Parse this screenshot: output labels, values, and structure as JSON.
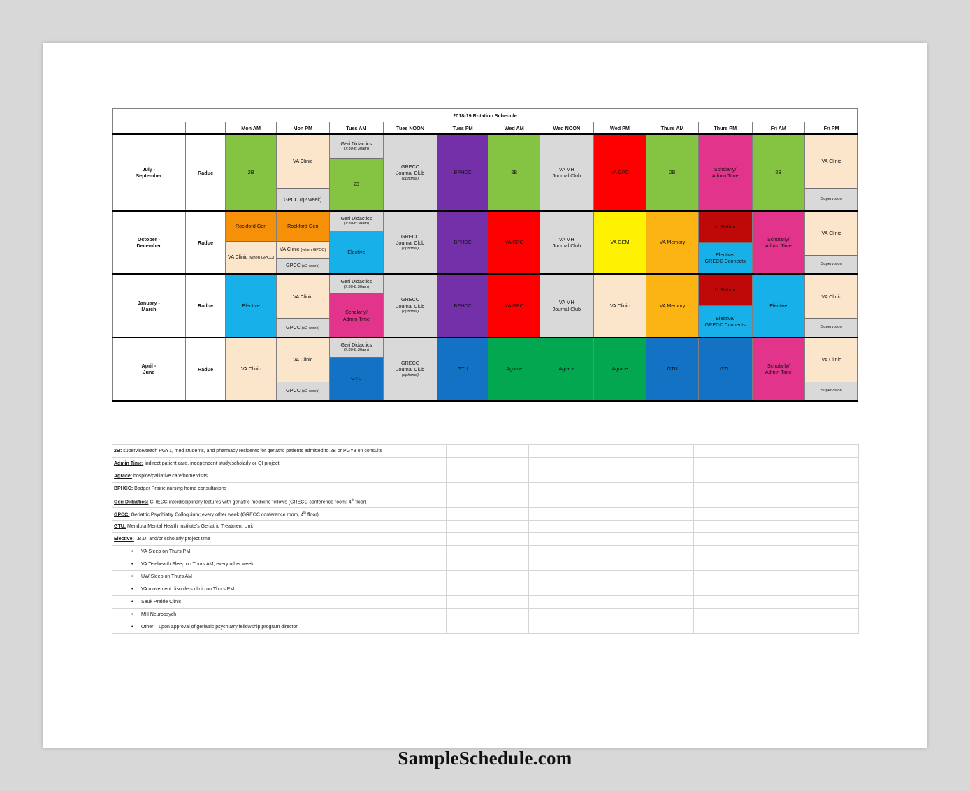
{
  "page": {
    "title": "2018-19 Rotation Schedule",
    "watermark": "SampleSchedule.com"
  },
  "columns": [
    {
      "key": "period",
      "label": ""
    },
    {
      "key": "fellow",
      "label": ""
    },
    {
      "key": "mon_am",
      "label": "Mon AM"
    },
    {
      "key": "mon_pm",
      "label": "Mon PM"
    },
    {
      "key": "tues_am",
      "label": "Tues AM"
    },
    {
      "key": "tues_noon",
      "label": "Tues NOON"
    },
    {
      "key": "tues_pm",
      "label": "Tues PM"
    },
    {
      "key": "wed_am",
      "label": "Wed AM"
    },
    {
      "key": "wed_noon",
      "label": "Wed NOON"
    },
    {
      "key": "wed_pm",
      "label": "Wed PM"
    },
    {
      "key": "thurs_am",
      "label": "Thurs AM"
    },
    {
      "key": "thurs_pm",
      "label": "Thurs PM"
    },
    {
      "key": "fri_am",
      "label": "Fri AM"
    },
    {
      "key": "fri_pm",
      "label": "Fri PM"
    }
  ],
  "colors": {
    "green": "#85c442",
    "cream": "#fbe5cb",
    "gray": "#d9d9d9",
    "purple": "#7330a8",
    "red": "#fe0000",
    "pink": "#e1348a",
    "orange": "#f79009",
    "cyan": "#17b0e8",
    "yellow": "#fff200",
    "amber": "#fcb415",
    "darkred": "#bf0908",
    "blue": "#1372c4",
    "emerald": "#03a74f",
    "white": "#ffffff"
  },
  "rows": [
    {
      "period": "July - September",
      "period_line1": "July -",
      "period_line2": "September",
      "fellow": "Radue",
      "cells": {
        "mon_am": {
          "segments": [
            {
              "text": "2B",
              "color": "green",
              "flex": 1
            }
          ]
        },
        "mon_pm": {
          "segments": [
            {
              "text": "VA Clinic",
              "color": "cream",
              "flex": 72
            },
            {
              "text": "GPCC (q2 week)",
              "color": "gray",
              "flex": 28,
              "note": "(q2 week)",
              "main": "GPCC"
            }
          ]
        },
        "tues_am": {
          "segments": [
            {
              "main": "Geri Didactics",
              "note": "(7:30-8:30am)",
              "color": "gray",
              "flex": 30
            },
            {
              "text": "23",
              "color": "green",
              "flex": 70
            }
          ]
        },
        "tues_noon": {
          "segments": [
            {
              "main": "GRECC",
              "main2": "Journal Club",
              "note_ital": "(optional)",
              "color": "gray",
              "flex": 1
            }
          ]
        },
        "tues_pm": {
          "segments": [
            {
              "text": "BPHCC",
              "color": "purple",
              "flex": 1
            }
          ]
        },
        "wed_am": {
          "segments": [
            {
              "text": "2B",
              "color": "green",
              "flex": 1
            }
          ]
        },
        "wed_noon": {
          "segments": [
            {
              "main": "VA MH",
              "main2": "Journal Club",
              "color": "gray",
              "flex": 1
            }
          ]
        },
        "wed_pm": {
          "segments": [
            {
              "text": "VA GPC",
              "color": "red",
              "flex": 1
            }
          ]
        },
        "thurs_am": {
          "segments": [
            {
              "text": "2B",
              "color": "green",
              "flex": 1
            }
          ]
        },
        "thurs_pm": {
          "segments": [
            {
              "main": "Scholarly/",
              "main2": "Admin Time",
              "color": "pink",
              "flex": 1
            }
          ]
        },
        "fri_am": {
          "segments": [
            {
              "text": "2B",
              "color": "green",
              "flex": 1
            }
          ]
        },
        "fri_pm": {
          "segments": [
            {
              "text": "VA Clinic",
              "color": "cream",
              "flex": 72
            },
            {
              "text": "Supervision",
              "color": "gray",
              "flex": 28,
              "small": true
            }
          ]
        }
      }
    },
    {
      "period": "October - December",
      "period_line1": "October -",
      "period_line2": "December",
      "fellow": "Radue",
      "cells": {
        "mon_am": {
          "segments": [
            {
              "text": "Rockford Geri",
              "color": "orange",
              "flex": 48
            },
            {
              "main": "VA Clinic",
              "note": "(when GPCC)",
              "color": "cream",
              "flex": 52
            }
          ]
        },
        "mon_pm": {
          "segments": [
            {
              "text": "Rockford Geri",
              "color": "orange",
              "flex": 50
            },
            {
              "main": "VA Clinic",
              "note": "(when GPCC)",
              "color": "cream",
              "flex": 26
            },
            {
              "main": "GPCC",
              "note": "(q2 week)",
              "color": "gray",
              "flex": 24
            }
          ]
        },
        "tues_am": {
          "segments": [
            {
              "main": "Geri Didactics",
              "note": "(7:30-8:30am)",
              "color": "gray",
              "flex": 30
            },
            {
              "text": "Elective",
              "color": "cyan",
              "flex": 70
            }
          ]
        },
        "tues_noon": {
          "segments": [
            {
              "main": "GRECC",
              "main2": "Journal Club",
              "note_ital": "(optional)",
              "color": "gray",
              "flex": 1
            }
          ]
        },
        "tues_pm": {
          "segments": [
            {
              "text": "BPHCC",
              "color": "purple",
              "flex": 1
            }
          ]
        },
        "wed_am": {
          "segments": [
            {
              "text": "VA GPC",
              "color": "red",
              "flex": 1
            }
          ]
        },
        "wed_noon": {
          "segments": [
            {
              "main": "VA MH",
              "main2": "Journal Club",
              "color": "gray",
              "flex": 1
            }
          ]
        },
        "wed_pm": {
          "segments": [
            {
              "text": "VA GEM",
              "color": "yellow",
              "flex": 1
            }
          ]
        },
        "thurs_am": {
          "segments": [
            {
              "text": "VA Memory",
              "color": "amber",
              "flex": 1
            }
          ]
        },
        "thurs_pm": {
          "segments": [
            {
              "text": "U Station",
              "color": "darkred",
              "flex": 50
            },
            {
              "main": "Elective/",
              "main2": "GRECC Connects",
              "color": "cyan",
              "flex": 50
            }
          ]
        },
        "fri_am": {
          "segments": [
            {
              "main": "Scholarly/",
              "main2": "Admin Time",
              "color": "pink",
              "flex": 1
            }
          ]
        },
        "fri_pm": {
          "segments": [
            {
              "text": "VA Clinic",
              "color": "cream",
              "flex": 72
            },
            {
              "text": "Supervision",
              "color": "gray",
              "flex": 28,
              "small": true
            }
          ]
        }
      }
    },
    {
      "period": "January - March",
      "period_line1": "January -",
      "period_line2": "March",
      "fellow": "Radue",
      "cells": {
        "mon_am": {
          "segments": [
            {
              "text": "Elective",
              "color": "cyan",
              "flex": 1
            }
          ]
        },
        "mon_pm": {
          "segments": [
            {
              "text": "VA Clinic",
              "color": "cream",
              "flex": 72
            },
            {
              "main": "GPCC",
              "note": "(q2 week)",
              "color": "gray",
              "flex": 28
            }
          ]
        },
        "tues_am": {
          "segments": [
            {
              "main": "Geri Didactics",
              "note": "(7:30-8:30am)",
              "color": "gray",
              "flex": 30
            },
            {
              "main": "Scholarly/",
              "main2": "Admin Time",
              "color": "pink",
              "flex": 70
            }
          ]
        },
        "tues_noon": {
          "segments": [
            {
              "main": "GRECC",
              "main2": "Journal Club",
              "note_ital": "(optional)",
              "color": "gray",
              "flex": 1
            }
          ]
        },
        "tues_pm": {
          "segments": [
            {
              "text": "BPHCC",
              "color": "purple",
              "flex": 1
            }
          ]
        },
        "wed_am": {
          "segments": [
            {
              "text": "VA GPC",
              "color": "red",
              "flex": 1
            }
          ]
        },
        "wed_noon": {
          "segments": [
            {
              "main": "VA MH",
              "main2": "Journal Club",
              "color": "gray",
              "flex": 1
            }
          ]
        },
        "wed_pm": {
          "segments": [
            {
              "text": "VA Clinic",
              "color": "cream",
              "flex": 1
            }
          ]
        },
        "thurs_am": {
          "segments": [
            {
              "text": "VA Memory",
              "color": "amber",
              "flex": 1
            }
          ]
        },
        "thurs_pm": {
          "segments": [
            {
              "text": "U Station",
              "color": "darkred",
              "flex": 50
            },
            {
              "main": "Elective/",
              "main2": "GRECC Connects",
              "color": "cyan",
              "flex": 50
            }
          ]
        },
        "fri_am": {
          "segments": [
            {
              "text": "Elective",
              "color": "cyan",
              "flex": 1
            }
          ]
        },
        "fri_pm": {
          "segments": [
            {
              "text": "VA Clinic",
              "color": "cream",
              "flex": 72
            },
            {
              "text": "Supervision",
              "color": "gray",
              "flex": 28,
              "small": true
            }
          ]
        }
      }
    },
    {
      "period": "April - June",
      "period_line1": "April -",
      "period_line2": "June",
      "fellow": "Radue",
      "cells": {
        "mon_am": {
          "segments": [
            {
              "text": "VA Clinic",
              "color": "cream",
              "flex": 1
            }
          ]
        },
        "mon_pm": {
          "segments": [
            {
              "text": "VA Clinic",
              "color": "cream",
              "flex": 72
            },
            {
              "main": "GPCC",
              "note": "(q2 week)",
              "color": "gray",
              "flex": 28
            }
          ]
        },
        "tues_am": {
          "segments": [
            {
              "main": "Geri Didactics",
              "note": "(7:30-8:30am)",
              "color": "gray",
              "flex": 30
            },
            {
              "text": "GTU",
              "color": "blue",
              "flex": 70
            }
          ]
        },
        "tues_noon": {
          "segments": [
            {
              "main": "GRECC",
              "main2": "Journal Club",
              "note_ital": "(optional)",
              "color": "gray",
              "flex": 1
            }
          ]
        },
        "tues_pm": {
          "segments": [
            {
              "text": "GTU",
              "color": "blue",
              "flex": 1
            }
          ]
        },
        "wed_am": {
          "segments": [
            {
              "text": "Agrace",
              "color": "emerald",
              "flex": 1
            }
          ]
        },
        "wed_noon": {
          "segments": [
            {
              "text": "Agrace",
              "color": "emerald",
              "flex": 1
            }
          ]
        },
        "wed_pm": {
          "segments": [
            {
              "text": "Agrace",
              "color": "emerald",
              "flex": 1
            }
          ]
        },
        "thurs_am": {
          "segments": [
            {
              "text": "GTU",
              "color": "blue",
              "flex": 1
            }
          ]
        },
        "thurs_pm": {
          "segments": [
            {
              "text": "GTU",
              "color": "blue",
              "flex": 1
            }
          ]
        },
        "fri_am": {
          "segments": [
            {
              "main": "Scholarly/",
              "main2": "Admin Time",
              "color": "pink",
              "flex": 1
            }
          ]
        },
        "fri_pm": {
          "segments": [
            {
              "text": "VA Clinic",
              "color": "cream",
              "flex": 72
            },
            {
              "text": "Supervision",
              "color": "gray",
              "flex": 28,
              "small": true
            }
          ]
        }
      }
    }
  ],
  "legend": [
    {
      "term": "2B:",
      "desc": "supervise/teach PGY1, med students, and pharmacy residents for geriatric patients admitted to 2B or PGY3 on consults"
    },
    {
      "term": "Admin Time:",
      "desc": "indirect patient care, independent study/scholarly or QI project"
    },
    {
      "term": "Agrace:",
      "desc": "hospice/palliative care/home visits"
    },
    {
      "term": "BPHCC:",
      "desc": "Badger Prairie nursing home consultations"
    },
    {
      "term": "Geri Didactics:",
      "desc": "GRECC interdisciplinary lectures with geriatric medicine fellows (GRECC conference room: 4th floor)",
      "sup": "th",
      "pre": "GRECC interdisciplinary lectures with geriatric medicine fellows (GRECC conference room: 4",
      "post": " floor)"
    },
    {
      "term": "GPCC:",
      "desc": "Geriatric Psychiatry Colloquium; every other week (GRECC conference room, 4th floor)",
      "sup": "th",
      "pre": "Geriatric Psychiatry Colloquium; every other week (GRECC conference room, 4",
      "post": " floor)"
    },
    {
      "term": "GTU:",
      "desc": "Mendota Mental Health Institute's Geriatric Treatment Unit"
    },
    {
      "term": "Elective:",
      "desc": "I.B.D. and/or scholarly project time"
    }
  ],
  "bullets": [
    "VA Sleep on Thurs PM",
    "VA Telehealth Sleep on Thurs AM; every other week",
    "UW Sleep on Thurs AM",
    "VA movement disorders clinic on Thurs PM",
    "Sauk Prairie Clinic",
    "MH Neuropsych",
    "Other – upon approval of geriatric psychiatry fellowship program director"
  ]
}
